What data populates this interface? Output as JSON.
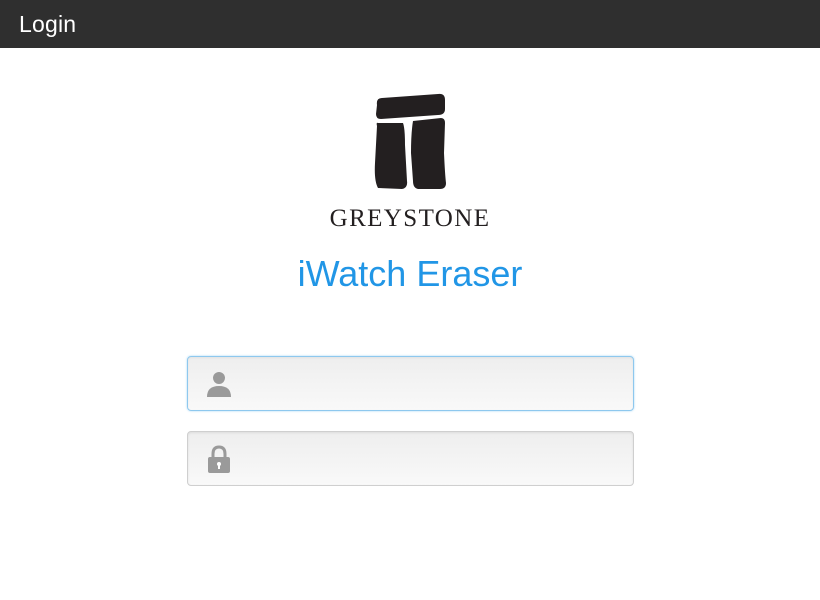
{
  "header": {
    "title": "Login"
  },
  "branding": {
    "logo_icon": "greystone-stones-logo",
    "company_name": "GREYSTONE",
    "app_name": "iWatch Eraser"
  },
  "login_form": {
    "username": {
      "icon": "user-icon",
      "value": "",
      "placeholder": ""
    },
    "password": {
      "icon": "lock-icon",
      "value": "",
      "placeholder": ""
    }
  },
  "colors": {
    "header_bg": "#2f2f2f",
    "accent": "#2196e6",
    "logo": "#231f20",
    "icon_gray": "#9a9a9a"
  }
}
